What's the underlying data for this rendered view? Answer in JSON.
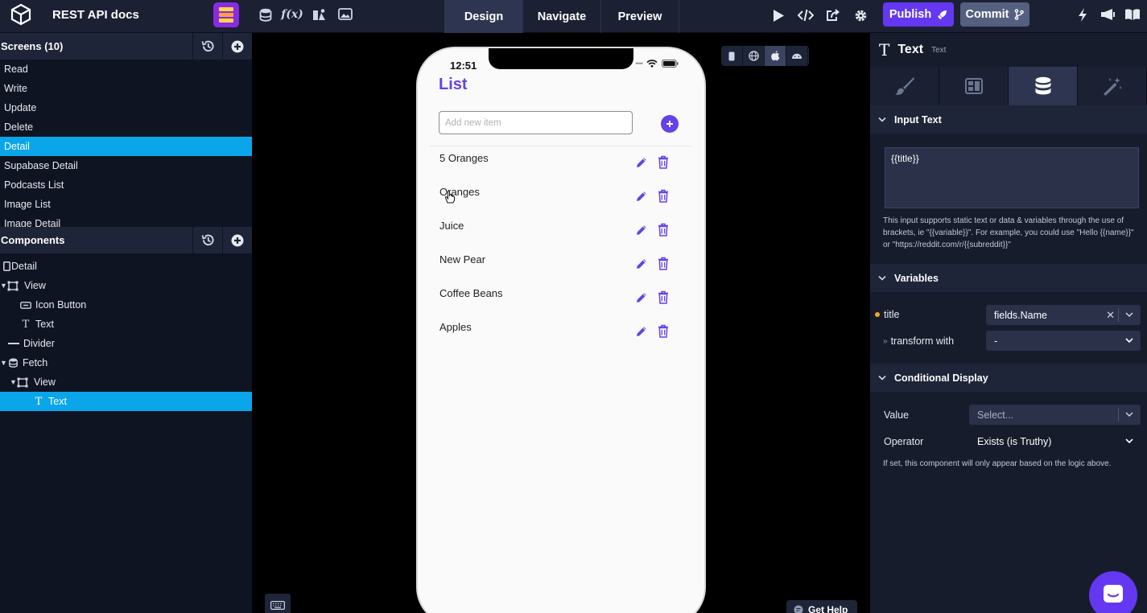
{
  "topbar": {
    "project_title": "REST API docs",
    "mode_tabs": [
      {
        "label": "Design",
        "active": true
      },
      {
        "label": "Navigate",
        "active": false
      },
      {
        "label": "Preview",
        "active": false
      }
    ],
    "fx_label": "f(x)",
    "publish_label": "Publish",
    "commit_label": "Commit"
  },
  "screens": {
    "header": "Screens (10)",
    "items": [
      {
        "label": "Read",
        "selected": false
      },
      {
        "label": "Write",
        "selected": false
      },
      {
        "label": "Update",
        "selected": false
      },
      {
        "label": "Delete",
        "selected": false
      },
      {
        "label": "Detail",
        "selected": true
      },
      {
        "label": "Supabase Detail",
        "selected": false
      },
      {
        "label": "Podcasts List",
        "selected": false
      },
      {
        "label": "Image List",
        "selected": false
      },
      {
        "label": "Image Detail",
        "selected": false
      }
    ]
  },
  "components": {
    "header": "Components",
    "items": [
      {
        "label": "Detail",
        "icon": "screen-icon",
        "depth": 0,
        "caret": false,
        "selected": false
      },
      {
        "label": "View",
        "icon": "view-icon",
        "depth": 0,
        "caret": true,
        "selected": false
      },
      {
        "label": "Icon Button",
        "icon": "button-icon",
        "depth": 2,
        "caret": false,
        "selected": false
      },
      {
        "label": "Text",
        "icon": "text-icon",
        "depth": 2,
        "caret": false,
        "selected": false
      },
      {
        "label": "Divider",
        "icon": "divider-icon",
        "depth": 1,
        "caret": false,
        "selected": false
      },
      {
        "label": "Fetch",
        "icon": "database-icon",
        "depth": 0,
        "caret": true,
        "selected": false
      },
      {
        "label": "View",
        "icon": "view-icon",
        "depth": 1,
        "caret": true,
        "selected": false
      },
      {
        "label": "Text",
        "icon": "text-icon",
        "depth": 3,
        "caret": false,
        "selected": true
      }
    ]
  },
  "phone": {
    "time": "12:51",
    "title": "List",
    "input_placeholder": "Add new item",
    "items": [
      "5 Oranges",
      "Oranges",
      "Juice",
      "New Pear",
      "Coffee Beans",
      "Apples"
    ]
  },
  "canvas": {
    "help_label": "Get Help"
  },
  "inspector": {
    "title": "Text",
    "subtitle": "Text",
    "input_text_header": "Input Text",
    "input_value": "{{title}}",
    "input_help": "This input supports static text or data & variables through the use of brackets, ie \"{{variable}}\". For example, you could use \"Hello {{name}}\" or \"https://reddit.com/r/{{subreddit}}\"",
    "variables_header": "Variables",
    "var_label": "title",
    "var_value": "fields.Name",
    "transform_label": "transform with",
    "transform_value": "-",
    "conditional_header": "Conditional Display",
    "value_label": "Value",
    "value_placeholder": "Select...",
    "operator_label": "Operator",
    "operator_value": "Exists (is Truthy)",
    "conditional_help": "If set, this component will only appear based on the logic above."
  },
  "colors": {
    "accent": "#6441e8",
    "selection": "#0ba5e9",
    "panel_bg": "#0f1422",
    "header_bg": "#1e2538"
  }
}
